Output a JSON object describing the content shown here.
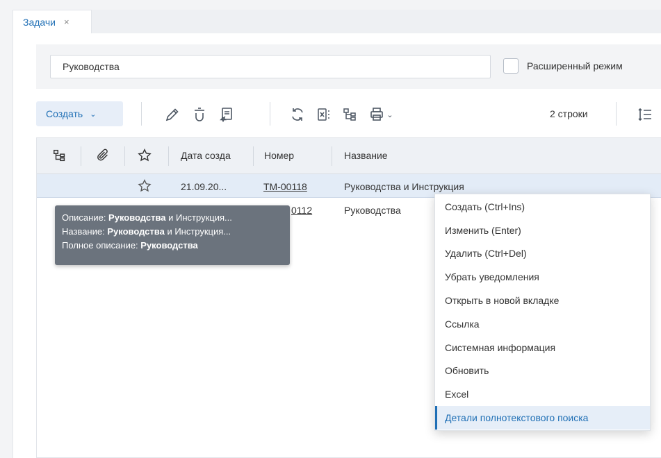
{
  "tab": {
    "label": "Задачи",
    "close": "×"
  },
  "search": {
    "value": "Руководства",
    "extended_mode_label": "Расширенный режим"
  },
  "toolbar": {
    "create_label": "Создать",
    "rows_count": "2 строки"
  },
  "table": {
    "columns": [
      "Дата созда",
      "Номер",
      "Название"
    ],
    "rows": [
      {
        "date": "21.09.20...",
        "number": "TM-00118",
        "title": "Руководства и Инструкция"
      },
      {
        "date": "",
        "number": "0112",
        "title": "Руководства"
      }
    ]
  },
  "tooltip": {
    "line1_label": "Описание: ",
    "line1_bold": "Руководства",
    "line1_rest": " и Инструкция...",
    "line2_label": "Название: ",
    "line2_bold": "Руководства",
    "line2_rest": " и Инструкция...",
    "line3_label": "Полное описание: ",
    "line3_bold": "Руководства"
  },
  "context_menu": {
    "items": [
      "Создать (Ctrl+Ins)",
      "Изменить (Enter)",
      "Удалить (Ctrl+Del)",
      "Убрать уведомления",
      "Открыть в новой вкладке",
      "Ссылка",
      "Системная информация",
      "Обновить",
      "Excel",
      "Детали полнотекстового поиска"
    ],
    "active_index": 9
  },
  "colors": {
    "accent": "#1f6fb5",
    "tooltip_bg": "#6b737d",
    "selected_row": "#e3ecf7"
  }
}
